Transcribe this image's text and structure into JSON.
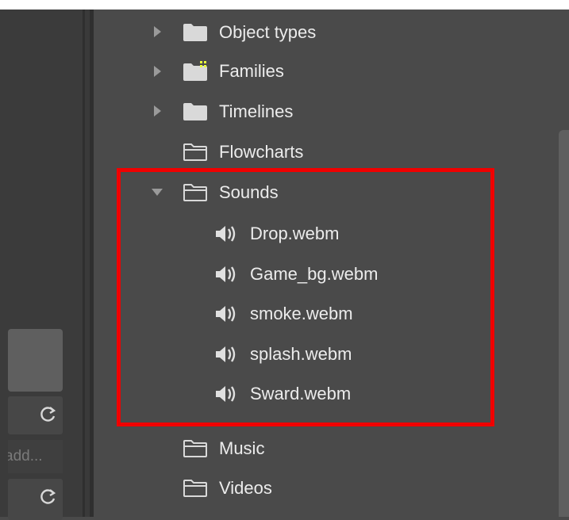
{
  "left_panel": {
    "add_input_text": "add...",
    "refresh_icon": "refresh-icon"
  },
  "tree": {
    "folders": [
      {
        "label": "Object types",
        "expanded": false,
        "has_arrow": true,
        "filled": true,
        "icon": "folder-filled-icon"
      },
      {
        "label": "Families",
        "expanded": false,
        "has_arrow": true,
        "filled": true,
        "icon": "families-folder-icon"
      },
      {
        "label": "Timelines",
        "expanded": false,
        "has_arrow": true,
        "filled": true,
        "icon": "folder-filled-icon"
      },
      {
        "label": "Flowcharts",
        "expanded": false,
        "has_arrow": false,
        "filled": false,
        "icon": "folder-outline-icon"
      },
      {
        "label": "Sounds",
        "expanded": true,
        "has_arrow": true,
        "filled": false,
        "icon": "folder-outline-icon"
      },
      {
        "label": "Music",
        "expanded": false,
        "has_arrow": false,
        "filled": false,
        "icon": "folder-outline-icon"
      },
      {
        "label": "Videos",
        "expanded": false,
        "has_arrow": false,
        "filled": false,
        "icon": "folder-outline-icon"
      }
    ],
    "sounds": [
      {
        "label": "Drop.webm",
        "icon": "speaker-icon"
      },
      {
        "label": "Game_bg.webm",
        "icon": "speaker-icon"
      },
      {
        "label": "smoke.webm",
        "icon": "speaker-icon"
      },
      {
        "label": "splash.webm",
        "icon": "speaker-icon"
      },
      {
        "label": "Sward.webm",
        "icon": "speaker-icon"
      }
    ]
  },
  "colors": {
    "highlight": "#f00000",
    "panel_bg": "#4a4a4a",
    "text": "#ececec"
  }
}
